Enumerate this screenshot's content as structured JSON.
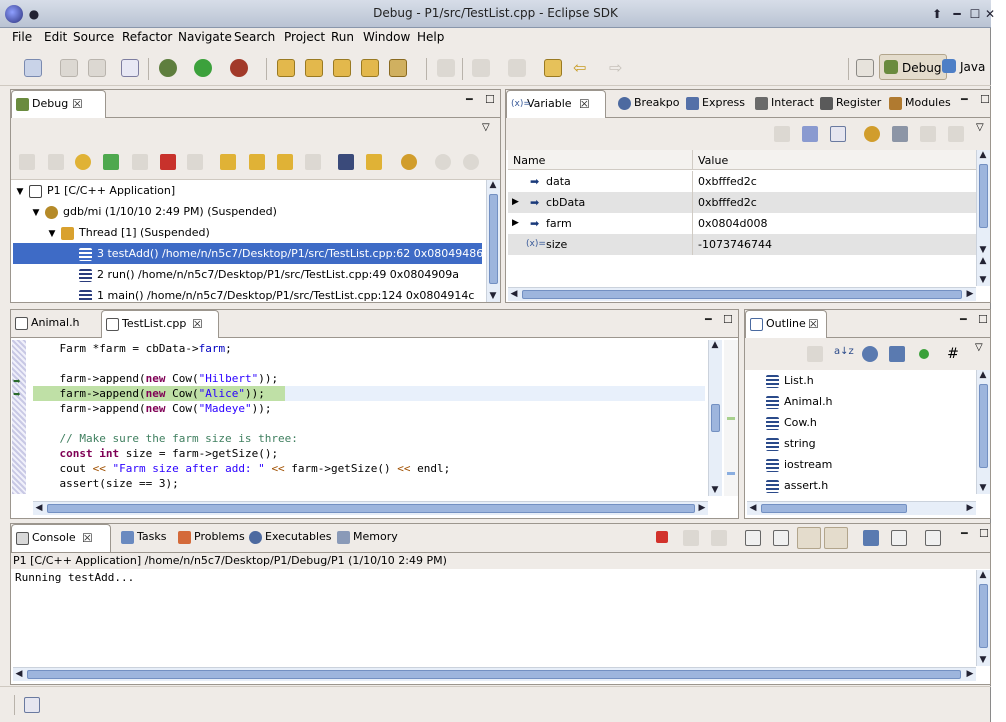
{
  "window": {
    "title": "Debug - P1/src/TestList.cpp - Eclipse SDK"
  },
  "menu": [
    "File",
    "Edit",
    "Source",
    "Refactor",
    "Navigate",
    "Search",
    "Project",
    "Run",
    "Window",
    "Help"
  ],
  "perspectives": {
    "debug": "Debug",
    "java": "Java"
  },
  "debug_view": {
    "tab": "Debug",
    "tree": [
      {
        "label": "P1 [C/C++ Application]",
        "depth": 0
      },
      {
        "label": "gdb/mi (1/10/10 2:49 PM) (Suspended)",
        "depth": 1
      },
      {
        "label": "Thread [1] (Suspended)",
        "depth": 2
      },
      {
        "label": "3 testAdd() /home/n/n5c7/Desktop/P1/src/TestList.cpp:62 0x08049486",
        "depth": 3,
        "selected": true
      },
      {
        "label": "2 run() /home/n/n5c7/Desktop/P1/src/TestList.cpp:49 0x0804909a",
        "depth": 3
      },
      {
        "label": "1 main() /home/n/n5c7/Desktop/P1/src/TestList.cpp:124 0x0804914c",
        "depth": 3
      }
    ]
  },
  "variables_view": {
    "tabs": [
      "Variable",
      "Breakpo",
      "Express",
      "Interact",
      "Register",
      "Modules"
    ],
    "columns": [
      "Name",
      "Value"
    ],
    "rows": [
      {
        "name": "data",
        "value": "0xbfffed2c"
      },
      {
        "name": "cbData",
        "value": "0xbfffed2c"
      },
      {
        "name": "farm",
        "value": "0x0804d008"
      },
      {
        "name": "size",
        "value": "-1073746744"
      }
    ]
  },
  "editor": {
    "tabs": [
      "Animal.h",
      "TestList.cpp"
    ],
    "lines": [
      "    Farm *farm = cbData->farm;",
      "",
      "    farm->append(new Cow(\"Hilbert\"));",
      "    farm->append(new Cow(\"Alice\"));",
      "    farm->append(new Cow(\"Madeye\"));",
      "",
      "    // Make sure the farm size is three:",
      "    const int size = farm->getSize();",
      "    cout << \"Farm size after add: \" << farm->getSize() << endl;",
      "    assert(size == 3);"
    ]
  },
  "outline": {
    "tab": "Outline",
    "items": [
      "List.h",
      "Animal.h",
      "Cow.h",
      "string",
      "iostream",
      "assert.h"
    ]
  },
  "console": {
    "tabs": [
      "Console",
      "Tasks",
      "Problems",
      "Executables",
      "Memory"
    ],
    "process": "P1 [C/C++ Application] /home/n/n5c7/Desktop/P1/Debug/P1 (1/10/10 2:49 PM)",
    "output": "Running testAdd..."
  }
}
